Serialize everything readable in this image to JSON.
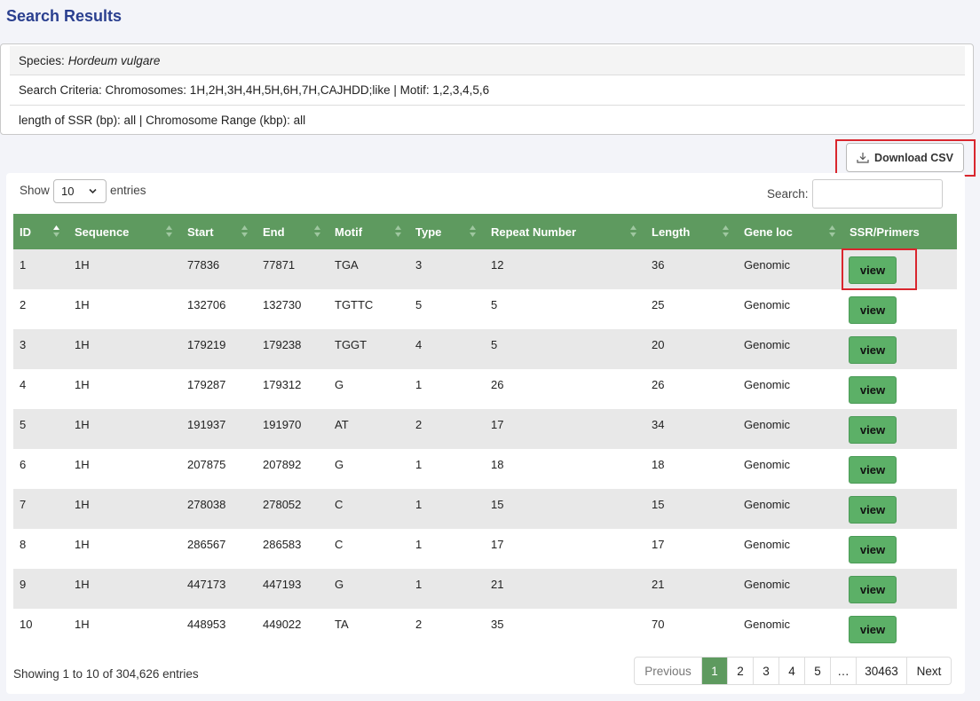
{
  "page_title": "Search Results",
  "criteria": {
    "species_label": "Species:",
    "species_value": "Hordeum vulgare",
    "search_criteria": "Search Criteria: Chromosomes: 1H,2H,3H,4H,5H,6H,7H,CAJHDD;like | Motif: 1,2,3,4,5,6",
    "length_range": "length of SSR (bp): all | Chromosome Range (kbp): all"
  },
  "toolbar": {
    "download_label": "Download CSV",
    "download_icon": "download-icon"
  },
  "controls": {
    "show_label": "Show",
    "entries_value": "10",
    "entries_label": "entries",
    "search_label": "Search:",
    "search_value": ""
  },
  "table": {
    "headers": [
      "ID",
      "Sequence",
      "Start",
      "End",
      "Motif",
      "Type",
      "Repeat Number",
      "Length",
      "Gene loc",
      "SSR/Primers"
    ],
    "rows": [
      {
        "id": "1",
        "sequence": "1H",
        "start": "77836",
        "end": "77871",
        "motif": "TGA",
        "type": "3",
        "repeat": "12",
        "length": "36",
        "gene_loc": "Genomic",
        "action": "view"
      },
      {
        "id": "2",
        "sequence": "1H",
        "start": "132706",
        "end": "132730",
        "motif": "TGTTC",
        "type": "5",
        "repeat": "5",
        "length": "25",
        "gene_loc": "Genomic",
        "action": "view"
      },
      {
        "id": "3",
        "sequence": "1H",
        "start": "179219",
        "end": "179238",
        "motif": "TGGT",
        "type": "4",
        "repeat": "5",
        "length": "20",
        "gene_loc": "Genomic",
        "action": "view"
      },
      {
        "id": "4",
        "sequence": "1H",
        "start": "179287",
        "end": "179312",
        "motif": "G",
        "type": "1",
        "repeat": "26",
        "length": "26",
        "gene_loc": "Genomic",
        "action": "view"
      },
      {
        "id": "5",
        "sequence": "1H",
        "start": "191937",
        "end": "191970",
        "motif": "AT",
        "type": "2",
        "repeat": "17",
        "length": "34",
        "gene_loc": "Genomic",
        "action": "view"
      },
      {
        "id": "6",
        "sequence": "1H",
        "start": "207875",
        "end": "207892",
        "motif": "G",
        "type": "1",
        "repeat": "18",
        "length": "18",
        "gene_loc": "Genomic",
        "action": "view"
      },
      {
        "id": "7",
        "sequence": "1H",
        "start": "278038",
        "end": "278052",
        "motif": "C",
        "type": "1",
        "repeat": "15",
        "length": "15",
        "gene_loc": "Genomic",
        "action": "view"
      },
      {
        "id": "8",
        "sequence": "1H",
        "start": "286567",
        "end": "286583",
        "motif": "C",
        "type": "1",
        "repeat": "17",
        "length": "17",
        "gene_loc": "Genomic",
        "action": "view"
      },
      {
        "id": "9",
        "sequence": "1H",
        "start": "447173",
        "end": "447193",
        "motif": "G",
        "type": "1",
        "repeat": "21",
        "length": "21",
        "gene_loc": "Genomic",
        "action": "view"
      },
      {
        "id": "10",
        "sequence": "1H",
        "start": "448953",
        "end": "449022",
        "motif": "TA",
        "type": "2",
        "repeat": "35",
        "length": "70",
        "gene_loc": "Genomic",
        "action": "view"
      }
    ]
  },
  "footer": {
    "info": "Showing 1 to 10 of 304,626 entries",
    "pagination": [
      "Previous",
      "1",
      "2",
      "3",
      "4",
      "5",
      "…",
      "30463",
      "Next"
    ],
    "active_page": "1"
  },
  "colors": {
    "title": "#2a3f8f",
    "header_bg": "#5e9a5f",
    "view_button": "#5cb067",
    "highlight": "#d9262e"
  }
}
